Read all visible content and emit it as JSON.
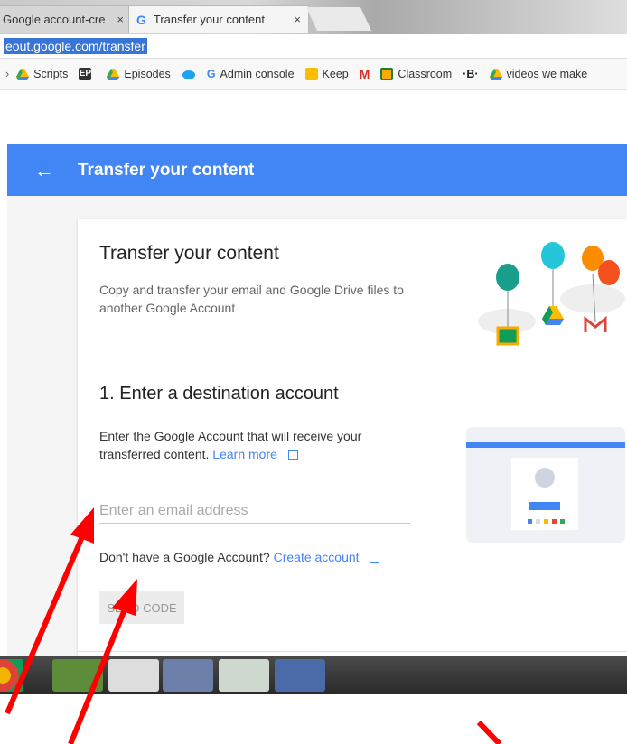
{
  "browser": {
    "tabs": [
      {
        "label": "Google account-cre",
        "close": "×"
      },
      {
        "label": "Transfer your content",
        "close": "×"
      }
    ],
    "url": "eout.google.com/transfer",
    "bookmarks": [
      {
        "label": "Scripts",
        "icon": "drive-icon"
      },
      {
        "label": "",
        "icon": "ep-icon"
      },
      {
        "label": "Episodes",
        "icon": "drive-icon"
      },
      {
        "label": "",
        "icon": "twitter-icon"
      },
      {
        "label": "Admin console",
        "icon": "google-icon"
      },
      {
        "label": "Keep",
        "icon": "keep-icon"
      },
      {
        "label": "",
        "icon": "gmail-icon"
      },
      {
        "label": "Classroom",
        "icon": "classroom-icon"
      },
      {
        "label": "",
        "icon": "b-icon"
      },
      {
        "label": "videos we make",
        "icon": "drive-icon"
      }
    ]
  },
  "header": {
    "back": "←",
    "title": "Transfer your content"
  },
  "intro": {
    "title": "Transfer your content",
    "description": "Copy and transfer your email and Google Drive files to another Google Account"
  },
  "step1": {
    "title": "1. Enter a destination account",
    "description": "Enter the Google Account that will receive your transferred content.",
    "learn_more": "Learn more",
    "email_placeholder": "Enter an email address",
    "no_account": "Don't have a Google Account?",
    "create_account": "Create account",
    "send_code": "SEND CODE"
  },
  "colors": {
    "accent": "#4285f4",
    "arrow": "#ff0000"
  }
}
